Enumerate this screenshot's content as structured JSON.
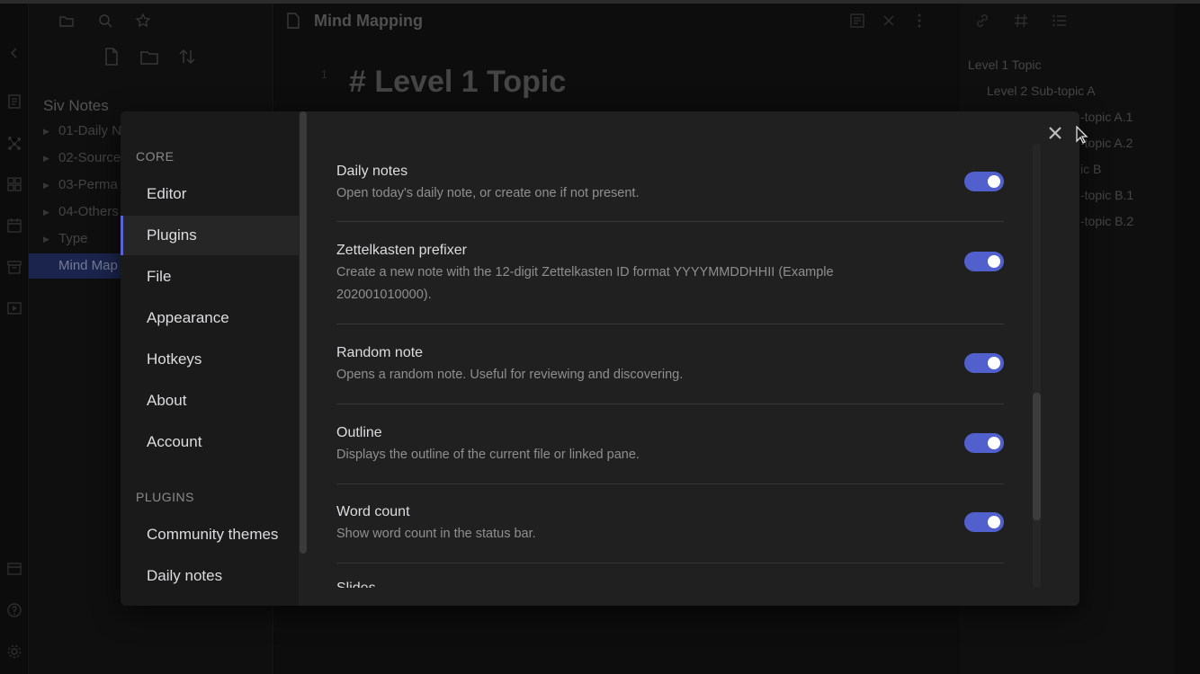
{
  "explorer": {
    "vault_name": "Siv Notes",
    "folders": [
      {
        "label": "01-Daily N"
      },
      {
        "label": "02-Source"
      },
      {
        "label": "03-Perma"
      },
      {
        "label": "04-Others"
      },
      {
        "label": "Type"
      }
    ],
    "active_file": "Mind Map"
  },
  "editor": {
    "tab_title": "Mind Mapping",
    "line_number": "1",
    "heading": "# Level 1 Topic"
  },
  "outline": {
    "items": [
      "Level 1 Topic",
      "Level 2 Sub-topic A",
      "-topic A.1",
      "-topic A.2",
      "ic B",
      "-topic B.1",
      "-topic B.2"
    ]
  },
  "settings": {
    "nav": {
      "core_header": "CORE",
      "core_items": [
        "Editor",
        "Plugins",
        "File",
        "Appearance",
        "Hotkeys",
        "About",
        "Account"
      ],
      "active_item": "Plugins",
      "plugins_header": "PLUGINS",
      "plugin_items": [
        "Community themes",
        "Daily notes"
      ]
    },
    "plugins": [
      {
        "name": "Daily notes",
        "desc": "Open today's daily note, or create one if not present.",
        "enabled": true
      },
      {
        "name": "Zettelkasten prefixer",
        "desc": "Create a new note with the 12-digit Zettelkasten ID format YYYYMMDDHHII (Example 202001010000).",
        "enabled": true
      },
      {
        "name": "Random note",
        "desc": "Opens a random note. Useful for reviewing and discovering.",
        "enabled": true
      },
      {
        "name": "Outline",
        "desc": "Displays the outline of the current file or linked pane.",
        "enabled": true
      },
      {
        "name": "Word count",
        "desc": "Show word count in the status bar.",
        "enabled": true
      }
    ],
    "next_item_partial": "Slides"
  },
  "colors": {
    "accent": "#5160cc",
    "modal_bg": "#202020",
    "nav_bg": "#1a1a1a"
  }
}
